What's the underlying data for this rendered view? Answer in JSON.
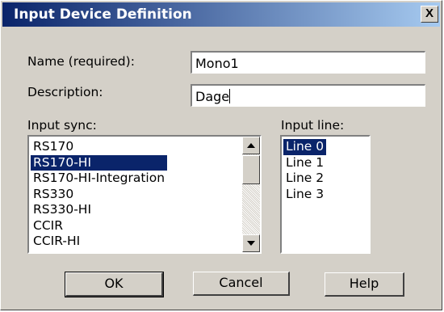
{
  "dialog": {
    "title": "Input Device Definition",
    "close_label": "X"
  },
  "form": {
    "name_label": "Name (required):",
    "name_value": "Mono1",
    "description_label": "Description:",
    "description_value": "Dage",
    "input_sync_label": "Input sync:",
    "input_line_label": "Input line:"
  },
  "input_sync": {
    "items": [
      "RS170",
      "RS170-HI",
      "RS170-HI-Integration",
      "RS330",
      "RS330-HI",
      "CCIR",
      "CCIR-HI"
    ],
    "selected": "RS170-HI"
  },
  "input_line": {
    "items": [
      "Line 0",
      "Line 1",
      "Line 2",
      "Line 3"
    ],
    "selected": "Line 0"
  },
  "buttons": {
    "ok": "OK",
    "cancel": "Cancel",
    "help": "Help"
  },
  "colors": {
    "face": "#d4d0c8",
    "title_start": "#0a246a",
    "title_end": "#a6caf0",
    "selection": "#0a246a"
  }
}
